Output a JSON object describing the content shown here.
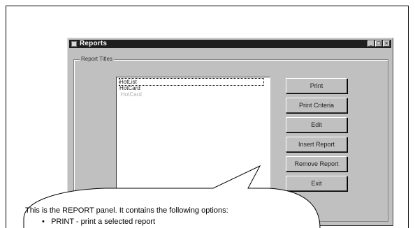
{
  "window": {
    "title": "Reports",
    "controls": {
      "minimize": "_",
      "maximize": "□",
      "close": "×"
    }
  },
  "group": {
    "label": "Report Titles"
  },
  "reports": {
    "items": [
      {
        "label": "HotList"
      },
      {
        "label": "HotCard"
      }
    ],
    "ghost_label": "HotCard"
  },
  "actions": {
    "print": "Print",
    "print_criteria": "Print Criteria",
    "edit": "Edit",
    "insert_report": "Insert Report",
    "remove_report": "Remove Report",
    "exit": "Exit"
  },
  "tooltip": {
    "intro": "This is the REPORT panel. It contains the following options:",
    "bullet_print": "PRINT - print a selected report"
  },
  "colors": {
    "window_face": "#c0c0c0",
    "titlebar": "#1f1f1f",
    "page_background": "#ffffff"
  }
}
